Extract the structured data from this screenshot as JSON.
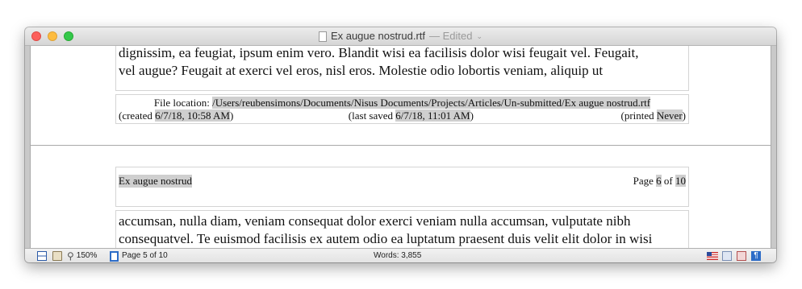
{
  "window": {
    "title": "Ex augue nostrud.rtf",
    "edited_label": "— Edited"
  },
  "page_a": {
    "body_line1": "dignissim, ea feugiat, ipsum enim vero. Blandit wisi ea facilisis dolor wisi feugait vel. Feugait,",
    "body_line2": "vel augue? Feugait at exerci vel eros, nisl eros. Molestie odio lobortis veniam, aliquip ut",
    "footer": {
      "file_location_label": "File location:",
      "file_location": "/Users/reubensimons/Documents/Nisus Documents/Projects/Articles/Un-submitted/Ex augue nostrud.rtf",
      "created_label": "(created",
      "created": "6/7/18, 10:58 AM",
      "last_saved_label": "(last saved",
      "last_saved": "6/7/18, 11:01 AM",
      "printed_label": "(printed",
      "printed": "Never",
      "close_paren": ")"
    }
  },
  "page_b": {
    "header_title": "Ex augue nostrud",
    "page_label": "Page",
    "page_num": "6",
    "of_label": "of",
    "page_total": "10",
    "body_line1": "accumsan, nulla diam, veniam consequat dolor exerci veniam nulla accumsan, vulputate nibh",
    "body_line2": "consequatvel. Te euismod facilisis ex autem odio ea luptatum praesent duis velit elit dolor in wisi"
  },
  "statusbar": {
    "zoom": "150%",
    "page_indicator": "Page 5 of 10",
    "words": "Words: 3,855"
  }
}
